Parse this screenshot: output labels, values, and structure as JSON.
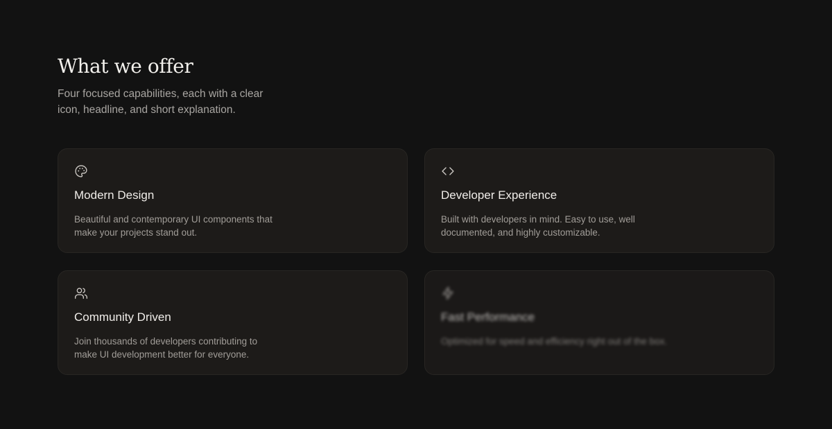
{
  "section": {
    "title": "What we offer",
    "subtitle": "Four focused capabilities, each with a clear icon, headline, and short explanation."
  },
  "cards": [
    {
      "icon": "palette-icon",
      "title": "Modern Design",
      "description": "Beautiful and contemporary UI components that make your projects stand out."
    },
    {
      "icon": "code-icon",
      "title": "Developer Experience",
      "description": "Built with developers in mind. Easy to use, well documented, and highly customizable."
    },
    {
      "icon": "users-icon",
      "title": "Community Driven",
      "description": "Join thousands of developers contributing to make UI development better for everyone."
    },
    {
      "icon": "zap-icon",
      "title": "Fast Performance",
      "description": "Optimized for speed and efficiency right out of the box."
    }
  ],
  "colors": {
    "background": "#121212",
    "card_background": "#1d1b19",
    "card_border": "#282623",
    "heading": "#f2f0ec",
    "body_text": "#a19d98"
  }
}
